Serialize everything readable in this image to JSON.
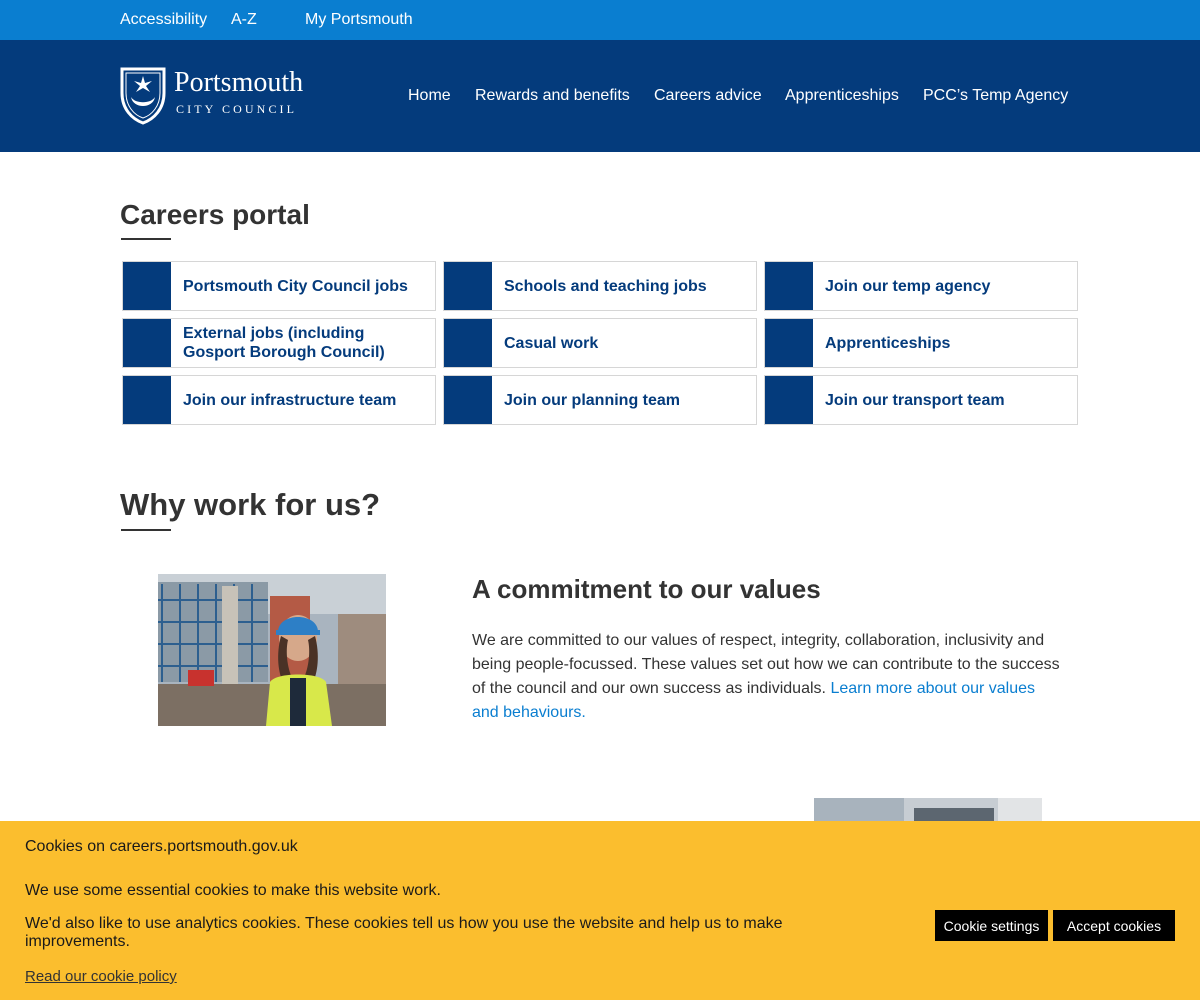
{
  "utility_nav": [
    "Accessibility",
    "A-Z",
    "My Portsmouth"
  ],
  "logo": {
    "name": "Portsmouth",
    "sub": "CITY COUNCIL"
  },
  "main_nav": [
    "Home",
    "Rewards and benefits",
    "Careers advice",
    "Apprenticeships",
    "PCC’s Temp Agency"
  ],
  "careers_portal": {
    "title": "Careers portal",
    "tiles": [
      "Portsmouth City Council jobs",
      "Schools and teaching jobs",
      "Join our temp agency",
      "External jobs (including Gosport Borough Council)",
      "Casual work",
      "Apprenticeships",
      "Join our infrastructure team",
      "Join our planning team",
      "Join our transport team"
    ]
  },
  "why": {
    "title": "Why work for us?",
    "values_heading": "A commitment to our values",
    "values_text": "We are committed to our values of respect, integrity, collaboration, inclusivity and being people-focussed. These values set out how we can contribute to the success of the council and our own success as individuals.",
    "values_link": "Learn more about our values and behaviours."
  },
  "cookie_banner": {
    "title": "Cookies on careers.portsmouth.gov.uk",
    "p1": "We use some essential cookies to make this website work.",
    "p2": "We'd also like to use analytics cookies. These cookies tell us how you use the website and help us to make improvements.",
    "policy_link": "Read our cookie policy",
    "settings_button": "Cookie settings",
    "accept_button": "Accept cookies"
  },
  "colors": {
    "utility_blue": "#0a7ed0",
    "navy": "#043b7c",
    "cookie_yellow": "#fbbe2e"
  }
}
